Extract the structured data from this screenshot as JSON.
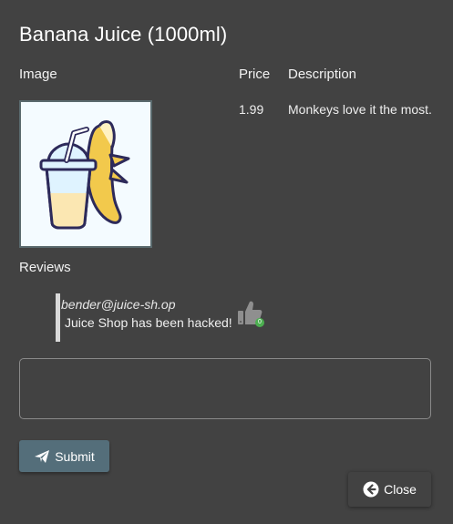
{
  "dialog": {
    "title": "Banana Juice (1000ml)"
  },
  "product": {
    "image_header": "Image",
    "price_header": "Price",
    "description_header": "Description",
    "price": "1.99",
    "description": "Monkeys love it the most.",
    "image_icon": "banana-juice-image"
  },
  "reviews": {
    "label": "Reviews",
    "items": [
      {
        "author": "bender@juice-sh.op",
        "text": "Juice Shop has been hacked!",
        "likes": "0",
        "like_icon": "thumbs-up-icon"
      }
    ]
  },
  "review_form": {
    "placeholder": "",
    "submit_label": "Submit",
    "submit_icon": "paper-plane-icon"
  },
  "actions": {
    "close_label": "Close",
    "close_icon": "arrow-circle-left-icon"
  },
  "colors": {
    "background": "#424242",
    "submit": "#546e7a",
    "like_badge": "#4caf50"
  }
}
